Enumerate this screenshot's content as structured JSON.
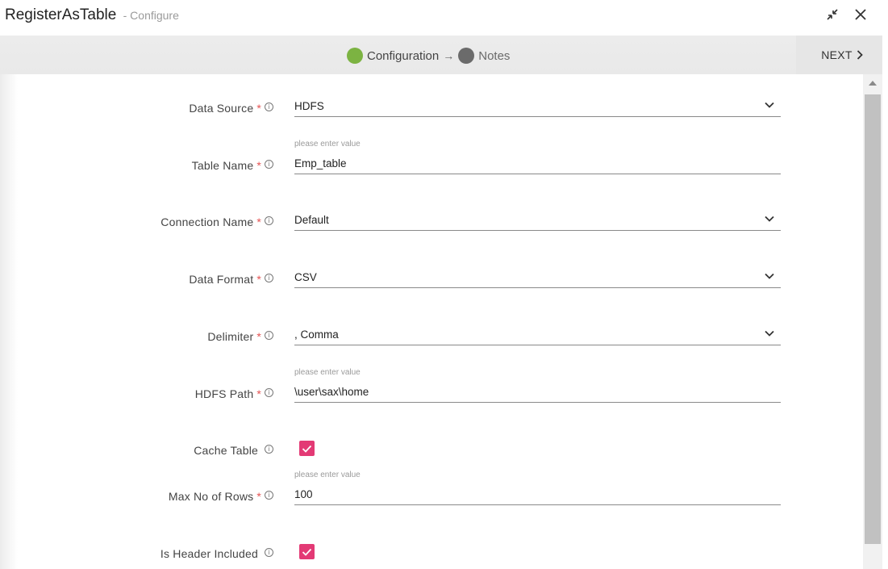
{
  "header": {
    "title": "RegisterAsTable",
    "subtitle": "- Configure"
  },
  "steps": [
    {
      "label": "Configuration",
      "color": "#7cb342"
    },
    {
      "label": "Notes",
      "color": "#6b6b6b"
    }
  ],
  "arrow": "→",
  "next_label": "NEXT",
  "form": {
    "data_source": {
      "label": "Data Source",
      "value": "HDFS"
    },
    "table_name": {
      "label": "Table Name",
      "value": "Emp_table",
      "hint": "please enter value"
    },
    "connection_name": {
      "label": "Connection Name",
      "value": "Default"
    },
    "data_format": {
      "label": "Data Format",
      "value": "CSV"
    },
    "delimiter": {
      "label": "Delimiter",
      "value": ", Comma"
    },
    "hdfs_path": {
      "label": "HDFS Path",
      "value": "\\user\\sax\\home",
      "hint": "please enter value"
    },
    "cache_table": {
      "label": "Cache Table",
      "checked": true
    },
    "max_rows": {
      "label": "Max No of Rows",
      "value": "100",
      "hint": "please enter value"
    },
    "header_included": {
      "label": "Is Header Included",
      "checked": true
    }
  },
  "required_mark": "*",
  "info_glyph": "i",
  "colors": {
    "checkbox": "#e33a75",
    "required": "#e55353"
  }
}
